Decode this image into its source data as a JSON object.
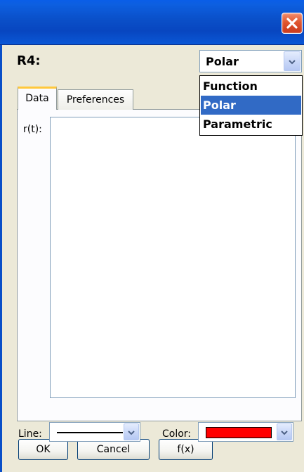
{
  "dialog": {
    "series_label": "R4:",
    "close_icon": "close-icon"
  },
  "type_combo": {
    "selected": "Polar",
    "options": [
      "Function",
      "Polar",
      "Parametric"
    ],
    "highlighted_index": 1
  },
  "tabs": [
    {
      "label": "Data",
      "active": true
    },
    {
      "label": "Preferences",
      "active": false
    }
  ],
  "data_tab": {
    "field_label": "r(t):",
    "field_value": ""
  },
  "style": {
    "line_label": "Line:",
    "color_label": "Color:",
    "color_value": "#ff0000"
  },
  "buttons": {
    "ok": "OK",
    "cancel": "Cancel",
    "fx": "f(x)"
  },
  "colors": {
    "titlebar": "#0a4fc8",
    "dialog_bg": "#ece9d8",
    "selection": "#316ac5",
    "close": "#e0562f",
    "active_tab_accent": "#ffc83c"
  }
}
